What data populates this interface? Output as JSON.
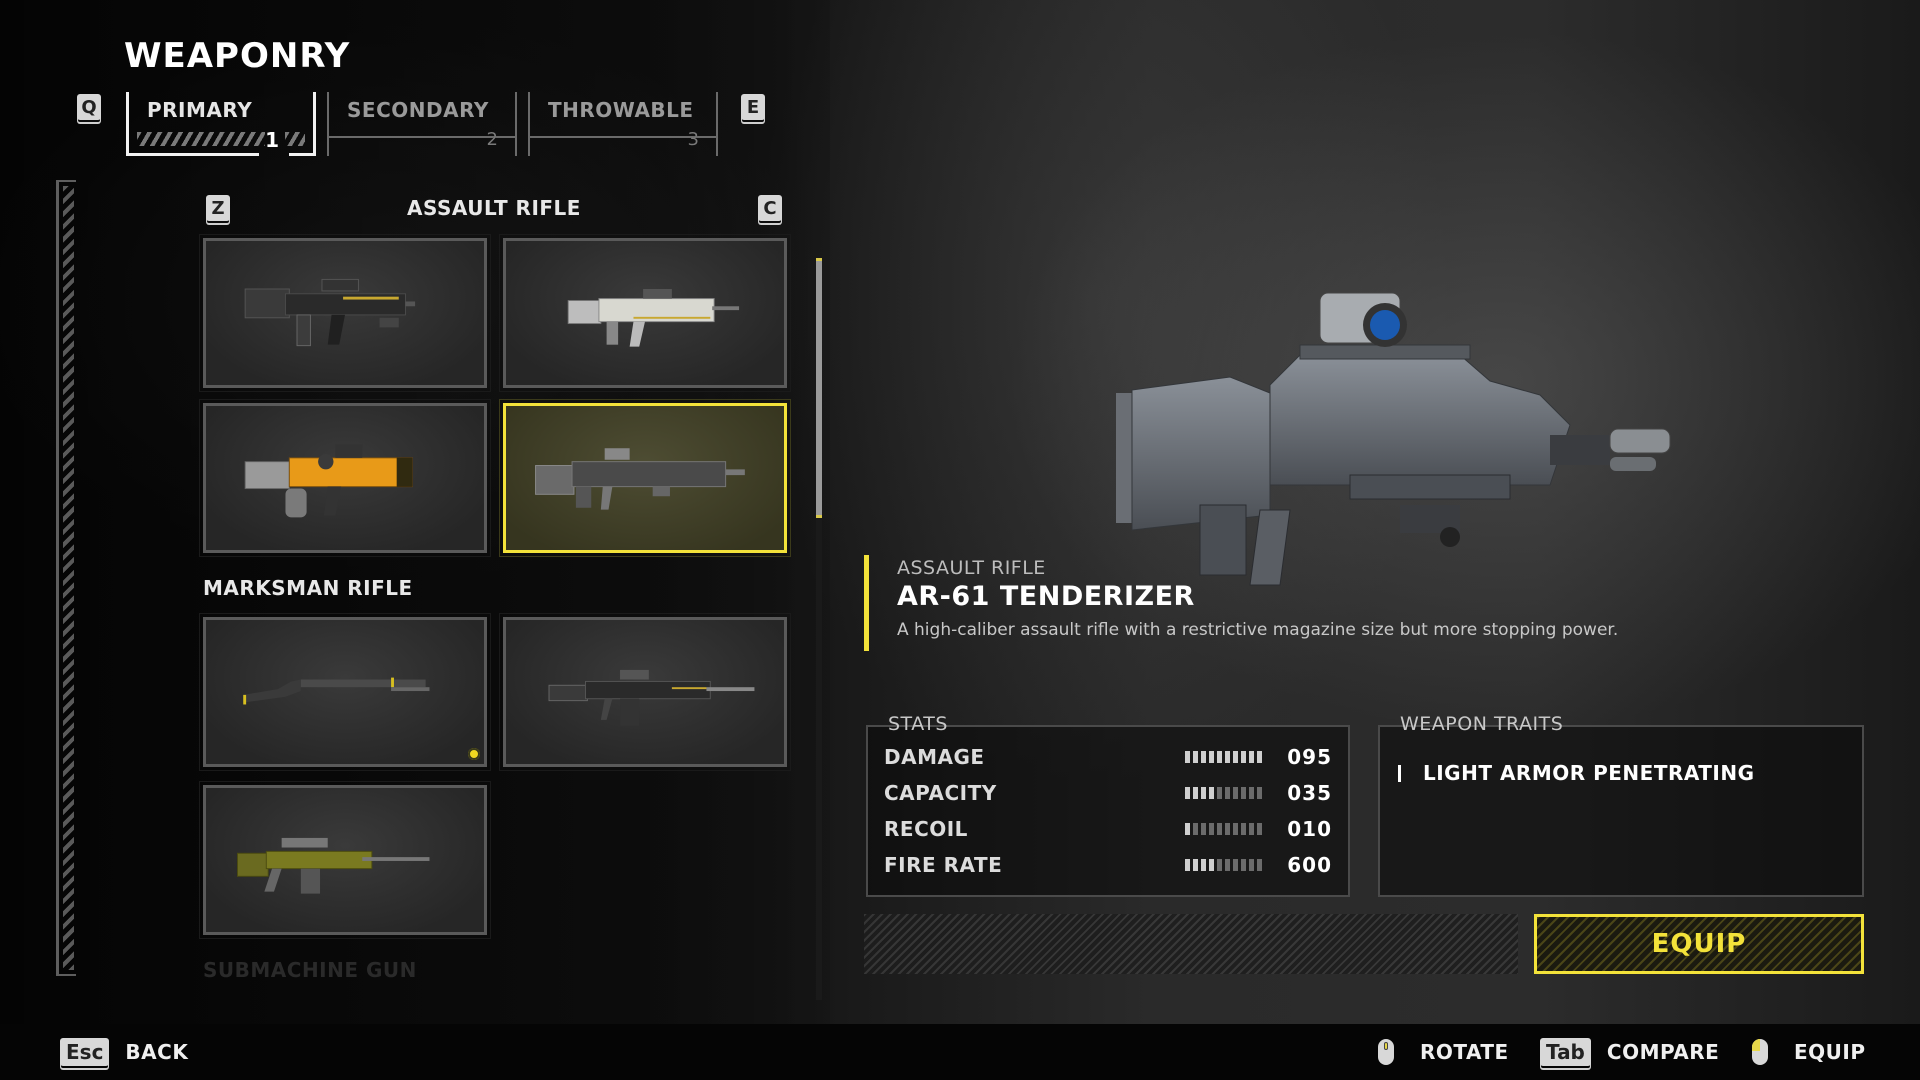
{
  "header": {
    "title": "WEAPONRY"
  },
  "tabs": {
    "prev_key": "Q",
    "next_key": "E",
    "items": [
      {
        "label": "PRIMARY",
        "number": "1",
        "active": true
      },
      {
        "label": "SECONDARY",
        "number": "2",
        "active": false
      },
      {
        "label": "THROWABLE",
        "number": "3",
        "active": false
      }
    ]
  },
  "category_nav": {
    "prev_key": "Z",
    "next_key": "C"
  },
  "categories": [
    {
      "title": "ASSAULT RIFLE",
      "weapons": [
        {
          "icon": "assault-rifle-black-icon",
          "selected": false,
          "accent": "#c8a830"
        },
        {
          "icon": "assault-rifle-white-icon",
          "selected": false,
          "accent": "#c8a830"
        },
        {
          "icon": "assault-rifle-orange-icon",
          "selected": false,
          "accent": "#f0a020"
        },
        {
          "icon": "assault-rifle-tenderizer-icon",
          "selected": true,
          "accent": "#888888"
        }
      ]
    },
    {
      "title": "MARKSMAN RIFLE",
      "weapons": [
        {
          "icon": "marksman-rifle-classic-icon",
          "selected": false,
          "new_badge": true,
          "accent": "#d8c020"
        },
        {
          "icon": "marksman-rifle-black-icon",
          "selected": false,
          "accent": "#c8a830"
        },
        {
          "icon": "marksman-rifle-olive-icon",
          "selected": false,
          "accent": "#7a7a20"
        }
      ]
    },
    {
      "title": "SUBMACHINE GUN",
      "weapons": []
    }
  ],
  "scroll": {
    "position_fraction": 0.0,
    "visible_fraction": 0.35
  },
  "selected_weapon": {
    "type": "ASSAULT RIFLE",
    "name": "AR-61 TENDERIZER",
    "description": "A high-caliber assault rifle with a restrictive magazine size but more stopping power.",
    "image": "ar-61-tenderizer-render"
  },
  "stats": {
    "title": "STATS",
    "rows": [
      {
        "name": "DAMAGE",
        "value": "095",
        "segments_filled": 10,
        "segments_total": 10
      },
      {
        "name": "CAPACITY",
        "value": "035",
        "segments_filled": 4,
        "segments_total": 10
      },
      {
        "name": "RECOIL",
        "value": "010",
        "segments_filled": 1,
        "segments_total": 10
      },
      {
        "name": "FIRE RATE",
        "value": "600",
        "segments_filled": 4,
        "segments_total": 10
      }
    ]
  },
  "traits": {
    "title": "WEAPON TRAITS",
    "items": [
      "LIGHT ARMOR PENETRATING"
    ]
  },
  "actions": {
    "equip_label": "EQUIP"
  },
  "footer": {
    "left": [
      {
        "key": "Esc",
        "label": "BACK"
      }
    ],
    "right": [
      {
        "key_icon": "mouse-middle-icon",
        "label": "ROTATE"
      },
      {
        "key": "Tab",
        "label": "COMPARE"
      },
      {
        "key_icon": "mouse-left-icon",
        "label": "EQUIP"
      }
    ]
  },
  "colors": {
    "accent": "#f3e23a",
    "text": "#e6e6e6",
    "muted": "#9a9a9a"
  }
}
